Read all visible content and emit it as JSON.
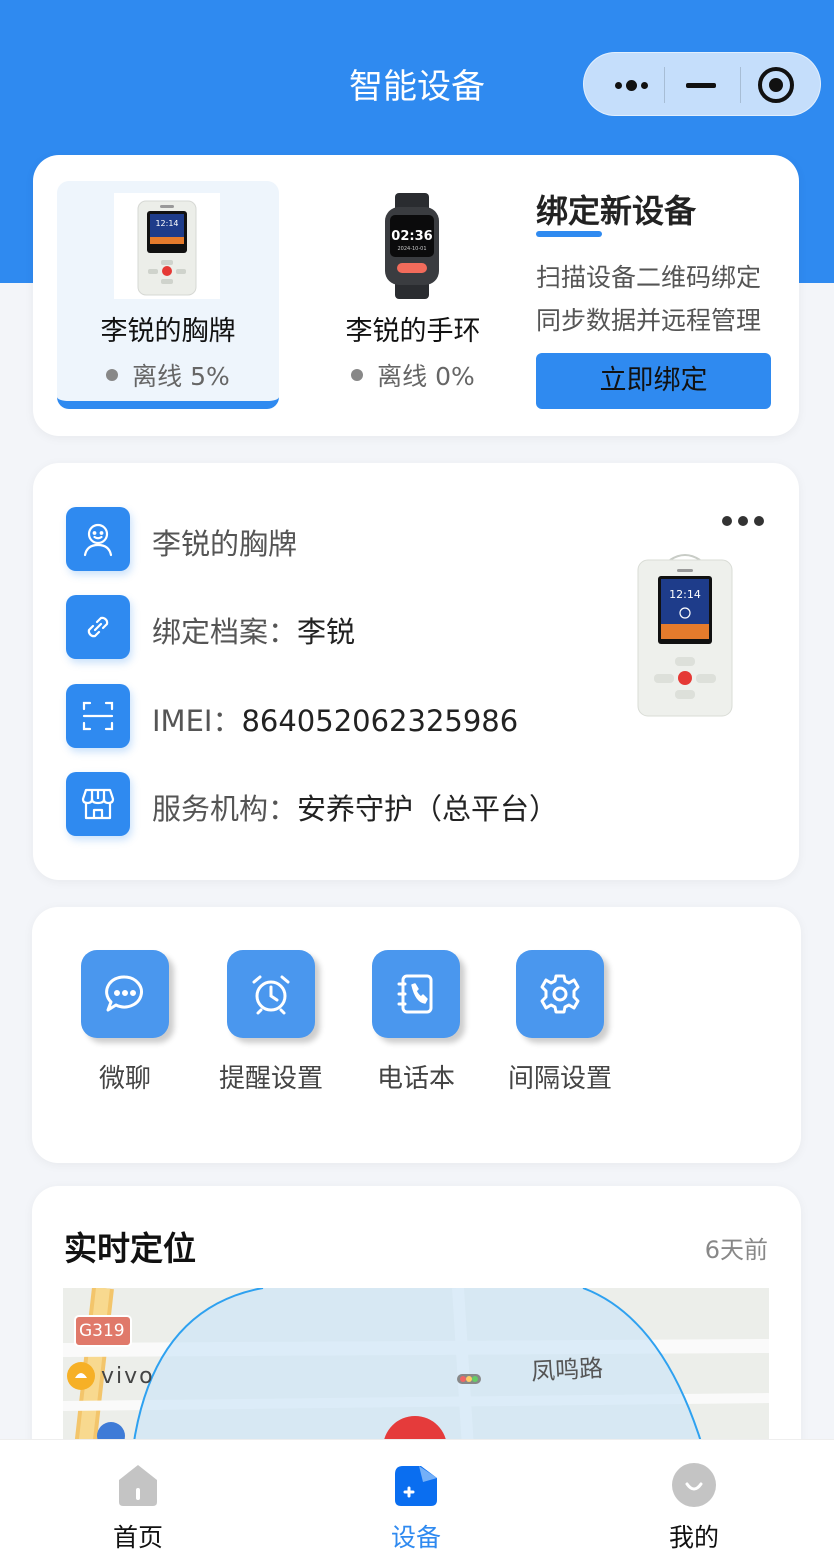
{
  "header": {
    "title": "智能设备"
  },
  "devices": [
    {
      "name": "李锐的胸牌",
      "status": "离线",
      "battery": "5%",
      "selected": true
    },
    {
      "name": "李锐的手环",
      "status": "离线",
      "battery": "0%",
      "selected": false
    }
  ],
  "bind_panel": {
    "title": "绑定新设备",
    "line1": "扫描设备二维码绑定",
    "line2": "同步数据并远程管理",
    "button": "立即绑定"
  },
  "info": {
    "device_name": "李锐的胸牌",
    "profile_label": "绑定档案：",
    "profile_value": "李锐",
    "imei_label": "IMEI：",
    "imei_value": "864052062325986",
    "org_label": "服务机构：",
    "org_value": "安养守护（总平台）"
  },
  "functions": [
    {
      "label": "微聊",
      "icon": "chat-icon"
    },
    {
      "label": "提醒设置",
      "icon": "alarm-clock-icon"
    },
    {
      "label": "电话本",
      "icon": "phonebook-icon"
    },
    {
      "label": "间隔设置",
      "icon": "gear-icon"
    }
  ],
  "location": {
    "title": "实时定位",
    "time": "6天前",
    "map_labels": {
      "road_code": "G319",
      "poi": "vivo",
      "road": "凤鸣路"
    }
  },
  "tabbar": [
    {
      "label": "首页",
      "icon": "home-icon",
      "active": false
    },
    {
      "label": "设备",
      "icon": "device-folder-icon",
      "active": true
    },
    {
      "label": "我的",
      "icon": "profile-icon",
      "active": false
    }
  ],
  "colors": {
    "primary": "#2f8af0",
    "background": "#f3f5f9",
    "offline_dot": "#888888"
  }
}
